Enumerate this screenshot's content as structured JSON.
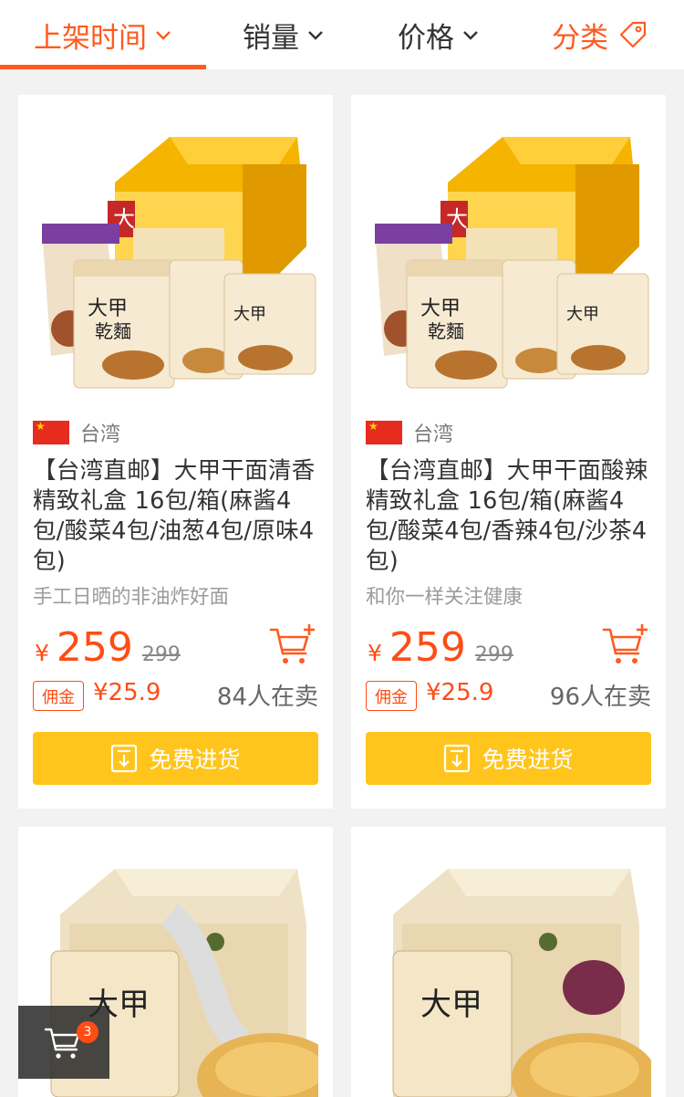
{
  "sort_bar": {
    "items": [
      {
        "label": "上架时间"
      },
      {
        "label": "销量"
      },
      {
        "label": "价格"
      },
      {
        "label": "分类"
      }
    ]
  },
  "colors": {
    "accent": "#ff5a1f",
    "price": "#ff4c15",
    "button": "#ffc51c"
  },
  "products": [
    {
      "origin": "台湾",
      "title": "【台湾直邮】大甲干面清香精致礼盒 16包/箱(麻酱4包/酸菜4包/油葱4包/原味4包)",
      "subtitle": "手工日晒的非油炸好面",
      "currency": "¥",
      "price": "259",
      "original_price": "299",
      "commission_label": "佣金",
      "commission": "¥25.9",
      "sellers": "84人在卖",
      "button_label": "免费进货"
    },
    {
      "origin": "台湾",
      "title": "【台湾直邮】大甲干面酸辣精致礼盒 16包/箱(麻酱4包/酸菜4包/香辣4包/沙茶4包)",
      "subtitle": "和你一样关注健康",
      "currency": "¥",
      "price": "259",
      "original_price": "299",
      "commission_label": "佣金",
      "commission": "¥25.9",
      "sellers": "96人在卖",
      "button_label": "免费进货"
    }
  ],
  "floating_cart": {
    "count": "3"
  }
}
